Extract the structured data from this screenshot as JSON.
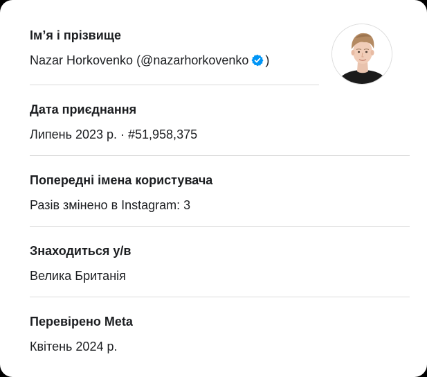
{
  "profile": {
    "name_label": "Ім’я і прізвище",
    "name_prefix": "Nazar Horkovenko (@nazarhorkovenko",
    "name_suffix": ")",
    "verified_icon": "verified-badge-icon",
    "verified_color": "#0095f6"
  },
  "joined": {
    "label": "Дата приєднання",
    "value": "Липень 2023 р. · #51,958,375"
  },
  "previous_usernames": {
    "label": "Попередні імена користувача",
    "value": "Разів змінено в Instagram: 3"
  },
  "location": {
    "label": "Знаходиться у/в",
    "value": "Велика Британія"
  },
  "verified_by": {
    "label": "Перевірено Meta",
    "value": "Квітень 2024 р."
  },
  "avatar": {
    "icon": "profile-photo"
  }
}
